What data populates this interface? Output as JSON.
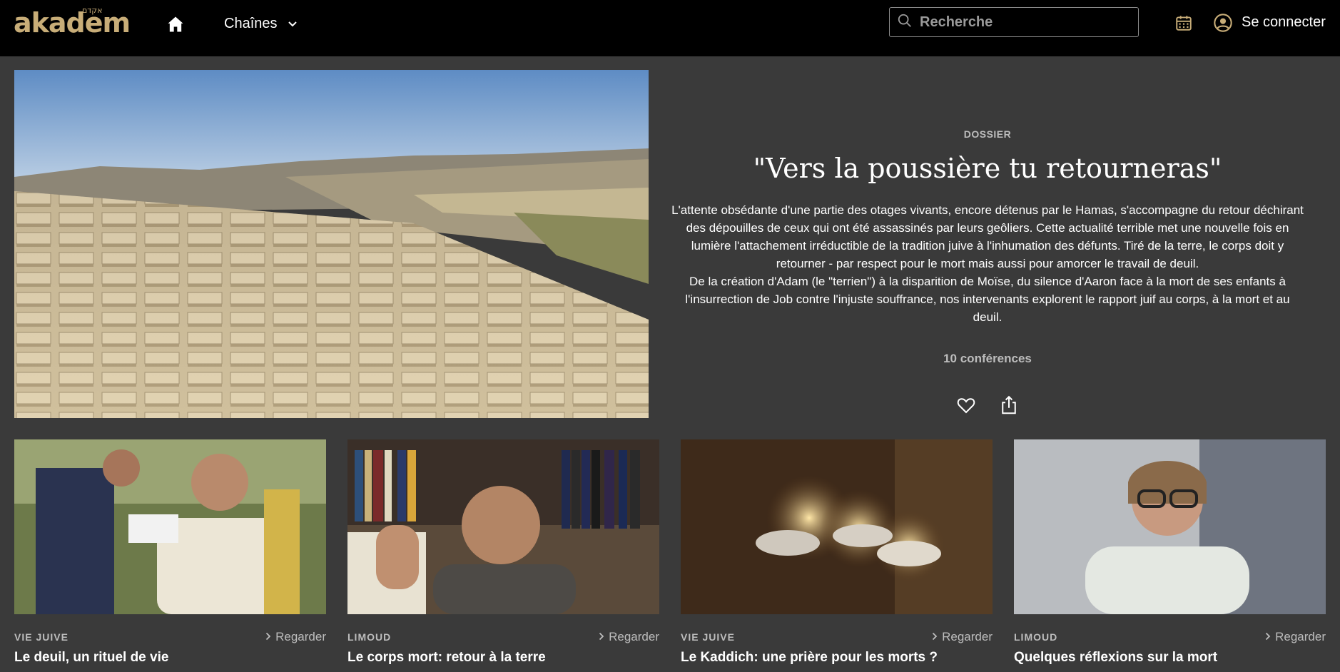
{
  "header": {
    "logo_text": "akadem",
    "logo_hebrew": "אקדם",
    "channels_label": "Chaînes",
    "search_placeholder": "Recherche",
    "login_label": "Se connecter"
  },
  "hero": {
    "label": "DOSSIER",
    "title": "\"Vers la poussière tu retourneras\"",
    "description_p1": "L'attente obsédante d'une partie des otages vivants, encore détenus par le Hamas, s'accompagne du retour déchirant des dépouilles de ceux qui ont été assassinés par leurs geôliers. Cette actualité terrible met une nouvelle fois en lumière l'attachement irréductible de la tradition juive à l'inhumation des défunts. Tiré de la terre, le corps doit y retourner - par respect pour le mort mais aussi pour amorcer le travail de deuil.",
    "description_p2": "De la création d'Adam (le \"terrien\") à la disparition de Moïse, du silence d'Aaron face à la mort de ses enfants à l'insurrection de Job contre l'injuste souffrance, nos intervenants explorent le rapport juif au corps, à la mort et au deuil.",
    "count": "10 conférences"
  },
  "cards": [
    {
      "category": "VIE JUIVE",
      "watch": "Regarder",
      "title": "Le deuil, un rituel de vie"
    },
    {
      "category": "LIMOUD",
      "watch": "Regarder",
      "title": "Le corps mort: retour à la terre"
    },
    {
      "category": "VIE JUIVE",
      "watch": "Regarder",
      "title": "Le Kaddich: une prière pour les morts ?"
    },
    {
      "category": "LIMOUD",
      "watch": "Regarder",
      "title": "Quelques réflexions sur la mort"
    }
  ],
  "colors": {
    "page_bg": "#3a3a3a",
    "header_bg": "#000000",
    "brand_gold": "#c8ad78",
    "muted_text": "#bdbdbd"
  },
  "icons": [
    "home-icon",
    "chevron-down-icon",
    "search-icon",
    "calendar-icon",
    "user-icon",
    "heart-icon",
    "share-icon",
    "chevron-right-icon"
  ]
}
